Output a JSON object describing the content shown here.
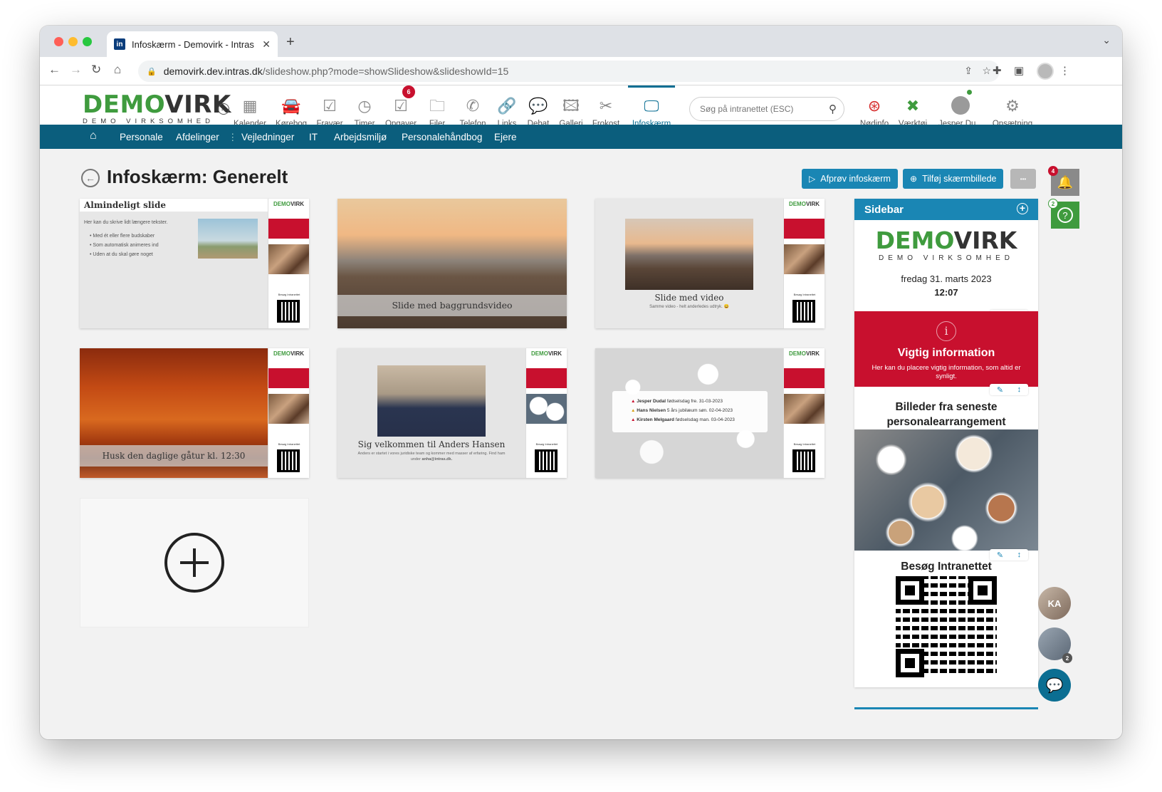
{
  "browser": {
    "tab_title": "Infoskærm - Demovirk - Intras",
    "tab_favicon": "in",
    "url_host": "demovirk.dev.intras.dk",
    "url_path": "/slideshow.php?mode=showSlideshow&slideshowId=15"
  },
  "header": {
    "logo_main_green": "DEMO",
    "logo_main_dark": "VIRK",
    "logo_sub": "DEMO VIRKSOMHED",
    "tools": [
      {
        "label": "Kalender",
        "icon": "calendar-icon"
      },
      {
        "label": "Kørebog",
        "icon": "car-icon"
      },
      {
        "label": "Fravær",
        "icon": "calendar-check-icon"
      },
      {
        "label": "Timer",
        "icon": "clock-icon"
      },
      {
        "label": "Opgaver",
        "icon": "checkbox-icon",
        "badge": "6"
      },
      {
        "label": "Filer",
        "icon": "folder-icon"
      },
      {
        "label": "Telefon",
        "icon": "phone-icon"
      },
      {
        "label": "Links",
        "icon": "link-icon"
      },
      {
        "label": "Debat",
        "icon": "chat-icon"
      },
      {
        "label": "Galleri",
        "icon": "image-icon"
      },
      {
        "label": "Frokost",
        "icon": "cutlery-icon"
      },
      {
        "label": "Infoskærm",
        "icon": "monitor-icon",
        "active": true
      }
    ],
    "search_placeholder": "Søg på intranettet (ESC)",
    "right_tools": [
      {
        "label": "Nødinfo",
        "icon": "lifebuoy-icon"
      },
      {
        "label": "Værktøj",
        "icon": "tools-icon"
      },
      {
        "label": "Jesper Du...",
        "icon": "user-avatar-icon"
      },
      {
        "label": "Opsætning",
        "icon": "gears-icon"
      }
    ],
    "colors": {
      "brand_green": "#3f9b3e",
      "nav_blue": "#0b5e7d",
      "accent_blue": "#1a86b4",
      "alert_red": "#c8102e"
    }
  },
  "nav": {
    "items": [
      "Personale",
      "Afdelinger",
      "Vejledninger",
      "IT",
      "Arbejdsmiljø",
      "Personalehåndbog",
      "Ejere"
    ]
  },
  "page": {
    "title": "Infoskærm: Generelt",
    "buttons": {
      "try": "Afprøv infoskærm",
      "add": "Tilføj skærmbillede",
      "more": "•••"
    }
  },
  "slides": [
    {
      "title": "Almindeligt slide",
      "text": "Her kan du skrive lidt længere tekster.",
      "bullets": [
        "Med ét eller flere budskaber",
        "Som automatisk animeres ind",
        "Uden at du skal gøre noget"
      ]
    },
    {
      "caption": "Slide med baggrundsvideo"
    },
    {
      "caption": "Slide med video",
      "sub": "Samme video - helt anderledes udtryk. 😀"
    },
    {
      "caption": "Husk den daglige gåtur kl. 12:30"
    },
    {
      "caption": "Sig velkommen til Anders Hansen",
      "sub": "Anders er startet i vores juridiske team og kommer med masser af erfaring. Find ham under",
      "sub_email": "anha@intras.dk."
    },
    {
      "events": [
        {
          "name": "Jesper Dudal",
          "text": "fødselsdag fre. 31-03-2023"
        },
        {
          "name": "Hans Nielsen",
          "text": "5 års jubilæum søn. 02-04-2023"
        },
        {
          "name": "Kirsten Melgaard",
          "text": "fødselsdag man. 03-04-2023"
        }
      ]
    }
  ],
  "sidebar": {
    "title": "Sidebar",
    "date": "fredag 31. marts 2023",
    "time": "12:07",
    "info_title": "Vigtig information",
    "info_text": "Her kan du placere vigtig information, som altid er synligt.",
    "photos_title": "Billeder fra seneste personalearrangement",
    "qr_title": "Besøg Intranettet"
  },
  "right_rail": {
    "notifications_badge": "4",
    "help_badge": "2",
    "avatar_initials": "KA",
    "group_badge": "2"
  }
}
